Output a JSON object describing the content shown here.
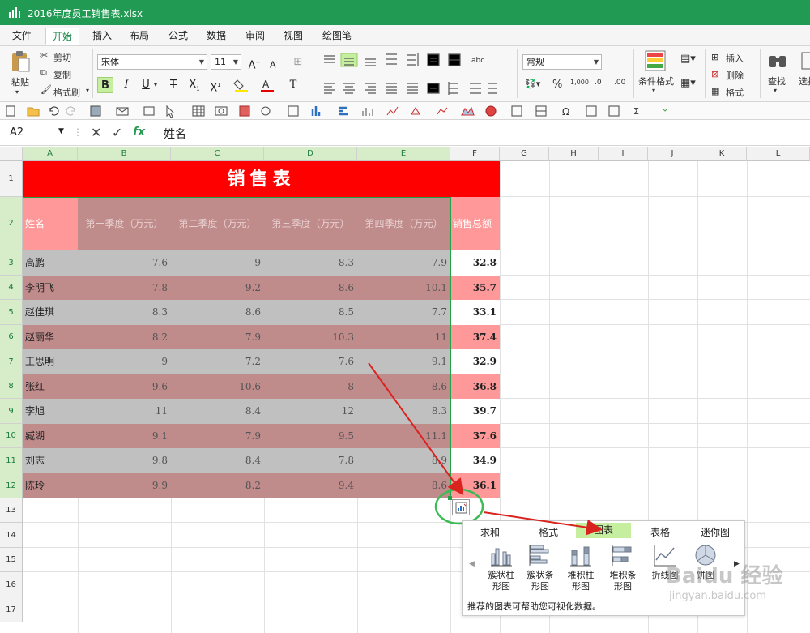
{
  "window": {
    "title": "2016年度员工销售表.xlsx"
  },
  "menu_tabs": [
    "文件",
    "开始",
    "插入",
    "布局",
    "公式",
    "数据",
    "审阅",
    "视图",
    "绘图笔"
  ],
  "ribbon": {
    "paste": "粘贴",
    "cut": "剪切",
    "copy": "复制",
    "format_painter": "格式刷",
    "font_name": "宋体",
    "font_size": "11",
    "number_format": "常规",
    "conditional_format": "条件格式",
    "insert": "插入",
    "delete": "删除",
    "format": "格式",
    "find": "查找",
    "select": "选择"
  },
  "formula_bar": {
    "name_box": "A2",
    "fx": "fx",
    "content": "姓名"
  },
  "columns": [
    "A",
    "B",
    "C",
    "D",
    "E",
    "F",
    "G",
    "H",
    "I",
    "J",
    "K",
    "L"
  ],
  "rows": [
    "1",
    "2",
    "3",
    "4",
    "5",
    "6",
    "7",
    "8",
    "9",
    "10",
    "11",
    "12",
    "13",
    "14",
    "15",
    "16",
    "17"
  ],
  "sheet": {
    "title": "销售表",
    "headers": [
      "姓名",
      "第一季度（万元）",
      "第二季度（万元）",
      "第三季度（万元）",
      "第四季度（万元）",
      "销售总额"
    ],
    "data": [
      [
        "高鹏",
        "7.6",
        "9",
        "8.3",
        "7.9",
        "32.8"
      ],
      [
        "李明飞",
        "7.8",
        "9.2",
        "8.6",
        "10.1",
        "35.7"
      ],
      [
        "赵佳琪",
        "8.3",
        "8.6",
        "8.5",
        "7.7",
        "33.1"
      ],
      [
        "赵丽华",
        "8.2",
        "7.9",
        "10.3",
        "11",
        "37.4"
      ],
      [
        "王思明",
        "9",
        "7.2",
        "7.6",
        "9.1",
        "32.9"
      ],
      [
        "张红",
        "9.6",
        "10.6",
        "8",
        "8.6",
        "36.8"
      ],
      [
        "李旭",
        "11",
        "8.4",
        "12",
        "8.3",
        "39.7"
      ],
      [
        "臧湖",
        "9.1",
        "7.9",
        "9.5",
        "11.1",
        "37.6"
      ],
      [
        "刘志",
        "9.8",
        "8.4",
        "7.8",
        "8.9",
        "34.9"
      ],
      [
        "陈玲",
        "9.9",
        "8.2",
        "9.4",
        "8.6",
        "36.1"
      ]
    ]
  },
  "quick_analysis": {
    "tabs": [
      "求和",
      "格式",
      "图表",
      "表格",
      "迷你图"
    ],
    "active_tab": "图表",
    "items": [
      {
        "label": "簇状柱\n形图",
        "icon": "clustered-column-icon"
      },
      {
        "label": "簇状条\n形图",
        "icon": "clustered-bar-icon"
      },
      {
        "label": "堆积柱\n形图",
        "icon": "stacked-column-icon"
      },
      {
        "label": "堆积条\n形图",
        "icon": "stacked-bar-icon"
      },
      {
        "label": "折线图",
        "icon": "line-chart-icon"
      },
      {
        "label": "饼图",
        "icon": "pie-chart-icon"
      }
    ],
    "hint": "推荐的图表可帮助您可视化数据。"
  },
  "watermark": {
    "brand": "Baidu 经验",
    "url": "jingyan.baidu.com"
  },
  "colors": {
    "titlebar": "#219a53",
    "title_fill": "#ff0000",
    "header_fill": "#ff9999",
    "row_gray": "#c0c0c0",
    "row_rose": "#c08b8b",
    "total_highlight": "#ff9999",
    "selection": "#22a34a",
    "arrow": "#d9231f",
    "active_tab_fill": "#c5ef9f"
  }
}
